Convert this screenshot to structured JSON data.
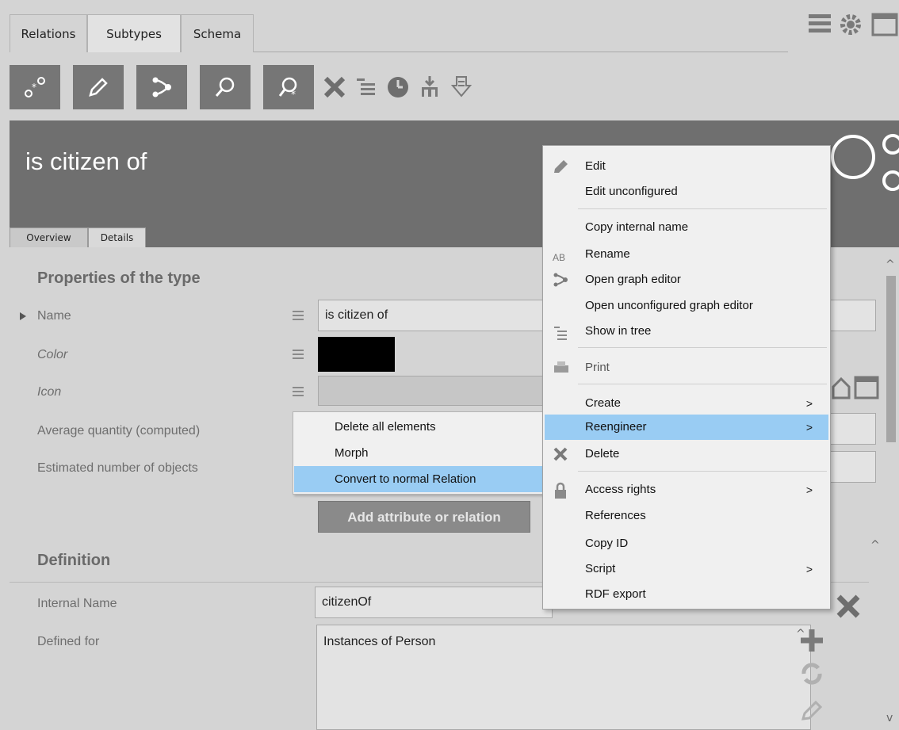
{
  "top_tabs": [
    "Relations",
    "Subtypes",
    "Schema"
  ],
  "header": {
    "title": "is citizen of"
  },
  "detail_tabs": [
    "Overview",
    "Details"
  ],
  "properties": {
    "section_title": "Properties of the type",
    "name_label": "Name",
    "name_value": "is citizen of",
    "color_label": "Color",
    "color_value": "#000000",
    "icon_label": "Icon",
    "avg_label": "Average quantity (computed)",
    "est_label": "Estimated number of objects",
    "add_button": "Add attribute or relation"
  },
  "definition": {
    "section_title": "Definition",
    "internal_name_label": "Internal Name",
    "internal_name_value": "citizenOf",
    "defined_for_label": "Defined for",
    "defined_for_value": "Instances of Person"
  },
  "context_menu": {
    "edit": "Edit",
    "edit_unconfigured": "Edit unconfigured",
    "copy_internal_name": "Copy internal name",
    "rename": "Rename",
    "open_graph_editor": "Open graph editor",
    "open_unconfigured_graph_editor": "Open unconfigured graph editor",
    "show_in_tree": "Show in tree",
    "print": "Print",
    "create": "Create",
    "reengineer": "Reengineer",
    "delete": "Delete",
    "access_rights": "Access rights",
    "references": "References",
    "copy_id": "Copy ID",
    "script": "Script",
    "rdf_export": "RDF export",
    "arrow": ">",
    "rename_icon_text": "AB"
  },
  "submenu": {
    "delete_all": "Delete all elements",
    "morph": "Morph",
    "convert": "Convert to normal Relation"
  },
  "colors": {
    "highlight": "#99ccf3",
    "header": "#6f6f6f",
    "toolbar_button": "#767676"
  }
}
